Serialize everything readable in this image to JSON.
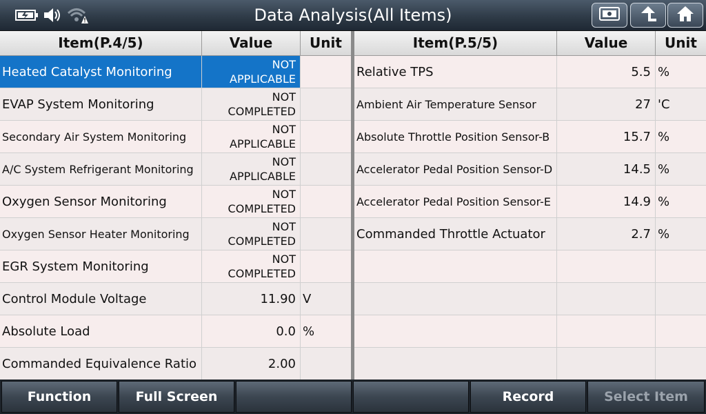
{
  "header": {
    "title": "Data Analysis(All Items)",
    "status_icons": [
      "battery-icon",
      "speaker-icon",
      "wifi-warning-icon"
    ],
    "buttons": [
      "snapshot-icon",
      "back-up-arrow-icon",
      "home-icon"
    ]
  },
  "left_table": {
    "headers": {
      "item": "Item(P.4/5)",
      "value": "Value",
      "unit": "Unit"
    },
    "rows": [
      {
        "item": "Heated Catalyst Monitoring",
        "value": [
          "NOT",
          "APPLICABLE"
        ],
        "unit": "",
        "selected": true
      },
      {
        "item": "EVAP System Monitoring",
        "value": [
          "NOT",
          "COMPLETED"
        ],
        "unit": ""
      },
      {
        "item": "Secondary Air System Monitoring",
        "value": [
          "NOT",
          "APPLICABLE"
        ],
        "unit": "",
        "small": true
      },
      {
        "item": "A/C System Refrigerant Monitoring",
        "value": [
          "NOT",
          "APPLICABLE"
        ],
        "unit": "",
        "small": true
      },
      {
        "item": "Oxygen Sensor Monitoring",
        "value": [
          "NOT",
          "COMPLETED"
        ],
        "unit": ""
      },
      {
        "item": "Oxygen Sensor Heater Monitoring",
        "value": [
          "NOT",
          "COMPLETED"
        ],
        "unit": "",
        "small": true
      },
      {
        "item": "EGR System Monitoring",
        "value": [
          "NOT",
          "COMPLETED"
        ],
        "unit": ""
      },
      {
        "item": "Control Module Voltage",
        "value": [
          "11.90"
        ],
        "unit": "V"
      },
      {
        "item": "Absolute Load",
        "value": [
          "0.0"
        ],
        "unit": "%"
      },
      {
        "item": "Commanded Equivalence Ratio",
        "value": [
          "2.00"
        ],
        "unit": ""
      }
    ]
  },
  "right_table": {
    "headers": {
      "item": "Item(P.5/5)",
      "value": "Value",
      "unit": "Unit"
    },
    "rows": [
      {
        "item": "Relative TPS",
        "value": [
          "5.5"
        ],
        "unit": "%"
      },
      {
        "item": "Ambient Air Temperature Sensor",
        "value": [
          "27"
        ],
        "unit": "'C",
        "small": true
      },
      {
        "item": "Absolute Throttle Position Sensor-B",
        "value": [
          "15.7"
        ],
        "unit": "%",
        "small": true
      },
      {
        "item": "Accelerator Pedal Position Sensor-D",
        "value": [
          "14.5"
        ],
        "unit": "%",
        "small": true
      },
      {
        "item": "Accelerator Pedal Position Sensor-E",
        "value": [
          "14.9"
        ],
        "unit": "%",
        "small": true
      },
      {
        "item": "Commanded Throttle Actuator",
        "value": [
          "2.7"
        ],
        "unit": "%"
      },
      {
        "item": "",
        "value": [],
        "unit": ""
      },
      {
        "item": "",
        "value": [],
        "unit": ""
      },
      {
        "item": "",
        "value": [],
        "unit": ""
      },
      {
        "item": "",
        "value": [],
        "unit": ""
      }
    ]
  },
  "footer": {
    "buttons": [
      {
        "label": "Function",
        "enabled": true
      },
      {
        "label": "Full Screen",
        "enabled": true
      },
      {
        "label": "",
        "enabled": true
      },
      {
        "label": "",
        "enabled": true
      },
      {
        "label": "Record",
        "enabled": true
      },
      {
        "label": "Select Item",
        "enabled": false
      }
    ]
  },
  "colors": {
    "selection": "#1474c8",
    "header_bar": "#2f3b48"
  }
}
